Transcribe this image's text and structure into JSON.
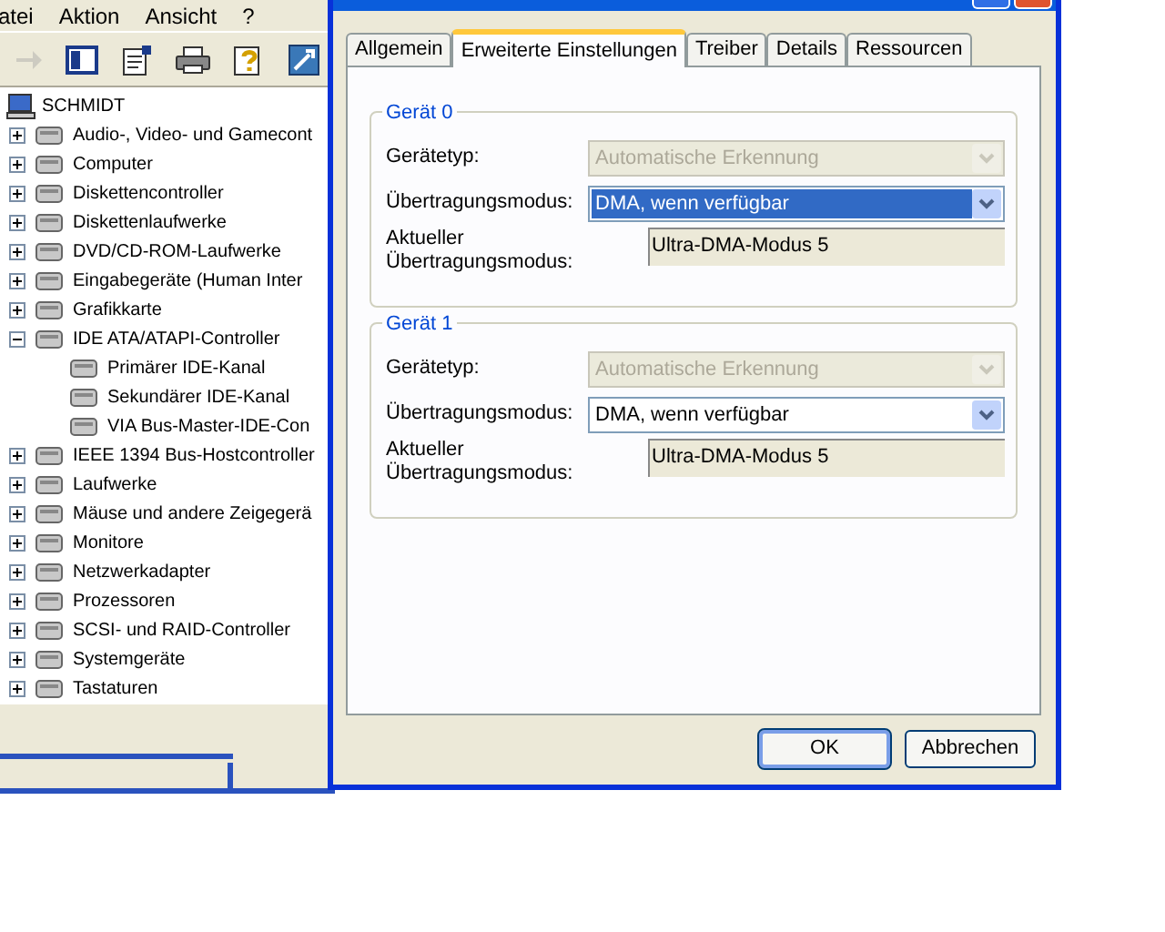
{
  "device_manager": {
    "menu": [
      {
        "label": "atei"
      },
      {
        "label": "Aktion"
      },
      {
        "label": "Ansicht"
      },
      {
        "label": "?"
      }
    ],
    "toolbar": [
      {
        "kind": "forward",
        "disabled": true
      },
      {
        "kind": "console_tree",
        "disabled": false
      },
      {
        "kind": "properties",
        "disabled": false
      },
      {
        "kind": "print",
        "disabled": false
      },
      {
        "kind": "help",
        "disabled": false
      },
      {
        "kind": "scan",
        "disabled": false
      }
    ],
    "tree": {
      "label": "SCHMIDT",
      "children": [
        {
          "label": "Audio-, Video- und Gamecont",
          "expanded": false
        },
        {
          "label": "Computer",
          "expanded": false
        },
        {
          "label": "Diskettencontroller",
          "expanded": false
        },
        {
          "label": "Diskettenlaufwerke",
          "expanded": false
        },
        {
          "label": "DVD/CD-ROM-Laufwerke",
          "expanded": false
        },
        {
          "label": "Eingabegeräte (Human Inter",
          "expanded": false
        },
        {
          "label": "Grafikkarte",
          "expanded": false
        },
        {
          "label": "IDE ATA/ATAPI-Controller",
          "expanded": true,
          "children": [
            {
              "label": "Primärer IDE-Kanal"
            },
            {
              "label": "Sekundärer IDE-Kanal"
            },
            {
              "label": "VIA Bus-Master-IDE-Con"
            }
          ]
        },
        {
          "label": "IEEE 1394 Bus-Hostcontroller",
          "expanded": false
        },
        {
          "label": "Laufwerke",
          "expanded": false
        },
        {
          "label": "Mäuse und andere Zeigegerä",
          "expanded": false
        },
        {
          "label": "Monitore",
          "expanded": false
        },
        {
          "label": "Netzwerkadapter",
          "expanded": false
        },
        {
          "label": "Prozessoren",
          "expanded": false
        },
        {
          "label": "SCSI- und RAID-Controller",
          "expanded": false
        },
        {
          "label": "Systemgeräte",
          "expanded": false
        },
        {
          "label": "Tastaturen",
          "expanded": false
        }
      ]
    }
  },
  "dialog": {
    "tabs": [
      {
        "label": "Allgemein",
        "selected": false
      },
      {
        "label": "Erweiterte Einstellungen",
        "selected": true
      },
      {
        "label": "Treiber",
        "selected": false
      },
      {
        "label": "Details",
        "selected": false
      },
      {
        "label": "Ressourcen",
        "selected": false
      }
    ],
    "groups": [
      {
        "title": "Gerät 0",
        "fields": [
          {
            "kind": "combo",
            "label": "Gerätetyp:",
            "value": "Automatische Erkennung",
            "disabled": true,
            "selected": false
          },
          {
            "kind": "combo",
            "label": "Übertragungsmodus:",
            "value": "DMA, wenn verfügbar",
            "disabled": false,
            "selected": true
          },
          {
            "kind": "readonly",
            "label": "Aktueller Übertragungsmodus:",
            "value": "Ultra-DMA-Modus 5"
          }
        ]
      },
      {
        "title": "Gerät 1",
        "fields": [
          {
            "kind": "combo",
            "label": "Gerätetyp:",
            "value": "Automatische Erkennung",
            "disabled": true,
            "selected": false
          },
          {
            "kind": "combo",
            "label": "Übertragungsmodus:",
            "value": "DMA, wenn verfügbar",
            "disabled": false,
            "selected": false
          },
          {
            "kind": "readonly",
            "label": "Aktueller Übertragungsmodus:",
            "value": "Ultra-DMA-Modus 5"
          }
        ]
      }
    ],
    "buttons": [
      {
        "label": "OK",
        "default": true
      },
      {
        "label": "Abbrechen",
        "default": false
      }
    ]
  }
}
